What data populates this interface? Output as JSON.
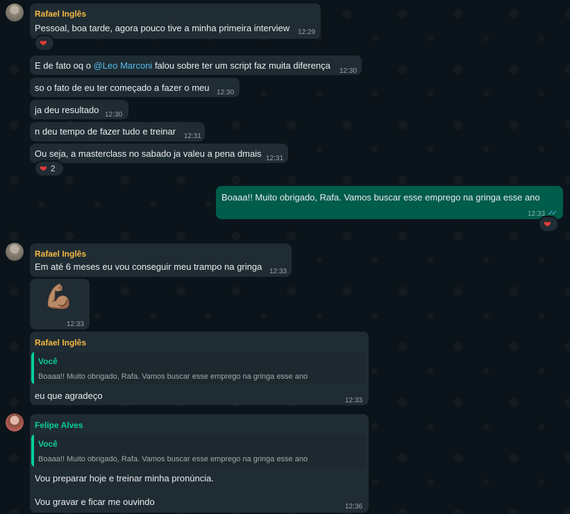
{
  "colors": {
    "background": "#0b141a",
    "incoming_bubble": "#202c33",
    "outgoing_bubble": "#005c4b",
    "rafael_name": "#f5b943",
    "felipe_name": "#06cf9c",
    "mention": "#53bdeb",
    "reaction_heart": "#e03b3b"
  },
  "messages": {
    "m1": {
      "sender": "Rafael Inglês",
      "text": "Pessoal, boa tarde, agora pouco tive a minha primeira interview",
      "time": "12:29",
      "reaction": {
        "icon": "heart-icon",
        "count": ""
      }
    },
    "m2": {
      "text_before": "E de fato oq o ",
      "mention": "@Leo Marconi",
      "text_after": " falou sobre ter um script faz muita diferença",
      "time": "12:30"
    },
    "m3": {
      "text": "so o fato de eu ter começado a fazer o meu",
      "time": "12:30"
    },
    "m4": {
      "text": "ja deu resultado",
      "time": "12:30"
    },
    "m5": {
      "text": "n deu tempo de fazer tudo e treinar",
      "time": "12:31"
    },
    "m6": {
      "text": "Ou seja, a masterclass no sabado ja valeu a pena dmais",
      "time": "12:31",
      "reaction": {
        "icon": "heart-icon",
        "count": "2"
      }
    },
    "m7": {
      "text": "Boaaa!! Muito obrigado, Rafa. Vamos buscar esse emprego na gringa esse ano",
      "time": "12:33",
      "status": "read-double-check-icon",
      "reaction": {
        "icon": "heart-icon",
        "count": ""
      }
    },
    "m8": {
      "sender": "Rafael Inglês",
      "text": "Em até 6 meses eu vou conseguir meu trampo na gringa",
      "time": "12:33"
    },
    "m9": {
      "emoji": "💪🏽",
      "time": "12:33"
    },
    "m10": {
      "sender": "Rafael Inglês",
      "quote_name": "Você",
      "quote_text": "Boaaa!! Muito obrigado, Rafa. Vamos buscar esse emprego na gringa esse ano",
      "text": "eu que agradeço",
      "time": "12:33"
    },
    "m11": {
      "sender": "Felipe Alves",
      "quote_name": "Você",
      "quote_text": "Boaaa!! Muito obrigado, Rafa. Vamos buscar esse emprego na gringa esse ano",
      "line1": "Vou preparar hoje e treinar minha pronúncia.",
      "line2": "Vou gravar e ficar me ouvindo",
      "time": "12:36"
    }
  }
}
